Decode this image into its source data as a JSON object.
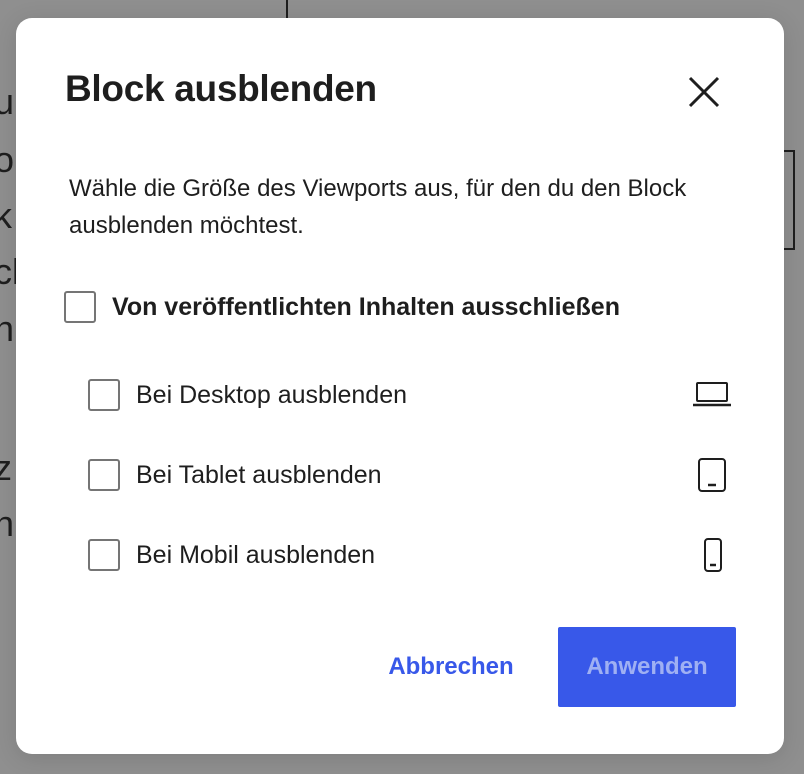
{
  "background": {
    "fragments": [
      "u",
      "o",
      "k",
      "cl",
      "n",
      "z",
      "n"
    ]
  },
  "modal": {
    "title": "Block ausblenden",
    "close_icon": "close-icon",
    "description": "Wähle die Größe des Viewports aus, für den du den Block ausblenden möchtest.",
    "exclude_option": {
      "label": "Von veröffentlichten Inhalten ausschließen",
      "checked": false
    },
    "viewport_options": [
      {
        "label": "Bei Desktop ausblenden",
        "icon": "desktop-icon",
        "checked": false
      },
      {
        "label": "Bei Tablet ausblenden",
        "icon": "tablet-icon",
        "checked": false
      },
      {
        "label": "Bei Mobil ausblenden",
        "icon": "mobile-icon",
        "checked": false
      }
    ],
    "actions": {
      "cancel_label": "Abbrechen",
      "apply_label": "Anwenden"
    }
  },
  "colors": {
    "accent": "#3858e9",
    "overlay": "#8f8f8f",
    "text": "#1e1e1e"
  }
}
